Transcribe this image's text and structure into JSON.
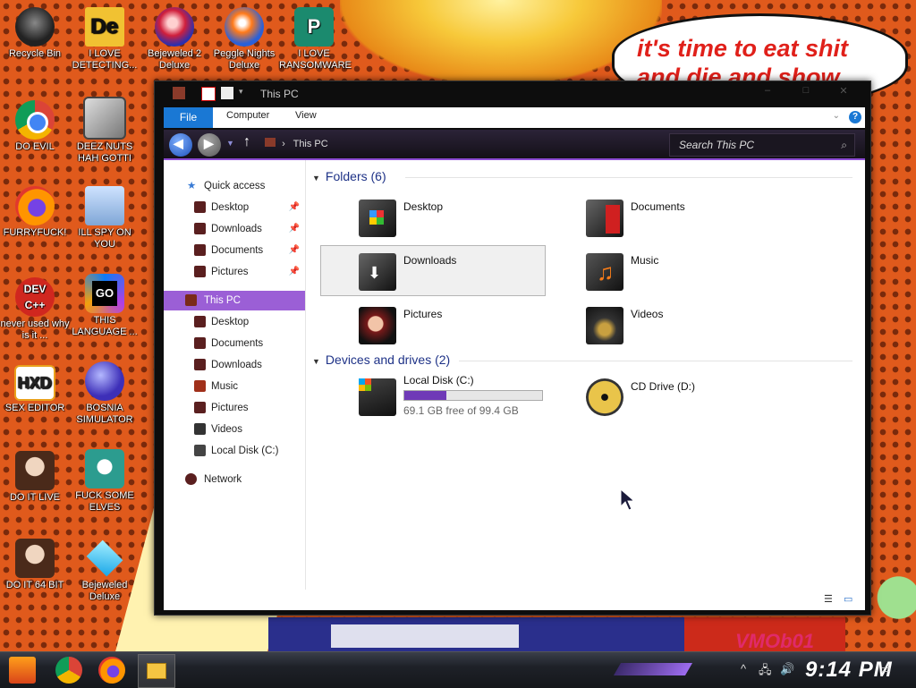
{
  "wallpaper": {
    "speech_text": "it's time to eat shit and die and show",
    "corner_text": "VMOb01"
  },
  "desktop_icons": [
    {
      "label": "Recycle Bin"
    },
    {
      "label": "DO EVIL"
    },
    {
      "label": "FURRYFUCK!"
    },
    {
      "label": "never used why is it ..."
    },
    {
      "label": "SEX EDITOR"
    },
    {
      "label": "DO IT LIVE"
    },
    {
      "label": "DO IT 64 BIT"
    },
    {
      "label": "I LOVE DETECTING..."
    },
    {
      "label": "DEEZ NUTS HAH GOTTI"
    },
    {
      "label": "ILL SPY ON YOU"
    },
    {
      "label": "THIS LANGUAGE ..."
    },
    {
      "label": "BOSNIA SIMULATOR"
    },
    {
      "label": "FUCK SOME ELVES"
    },
    {
      "label": "Bejeweled Deluxe"
    },
    {
      "label": "Bejeweled 2 Deluxe"
    },
    {
      "label": "Peggle Nights Deluxe"
    },
    {
      "label": "I LOVE RANSOMWARE"
    }
  ],
  "window": {
    "title": "This PC",
    "tabs": {
      "file": "File",
      "computer": "Computer",
      "view": "View"
    },
    "help": "?",
    "address": "This PC",
    "search_placeholder": "Search This PC"
  },
  "nav": {
    "quick_access": "Quick access",
    "qa_items": [
      "Desktop",
      "Downloads",
      "Documents",
      "Pictures"
    ],
    "this_pc": "This PC",
    "pc_items": [
      "Desktop",
      "Documents",
      "Downloads",
      "Music",
      "Pictures",
      "Videos",
      "Local Disk (C:)"
    ],
    "network": "Network"
  },
  "folders": {
    "header": "Folders (6)",
    "items": [
      "Desktop",
      "Documents",
      "Downloads",
      "Music",
      "Pictures",
      "Videos"
    ]
  },
  "drives": {
    "header": "Devices and drives (2)",
    "c": {
      "name": "Local Disk (C:)",
      "free": "69.1 GB free of 99.4 GB",
      "used_fraction": 0.305
    },
    "d": {
      "name": "CD Drive (D:)"
    }
  },
  "taskbar": {
    "clock": "9:14 PM"
  }
}
